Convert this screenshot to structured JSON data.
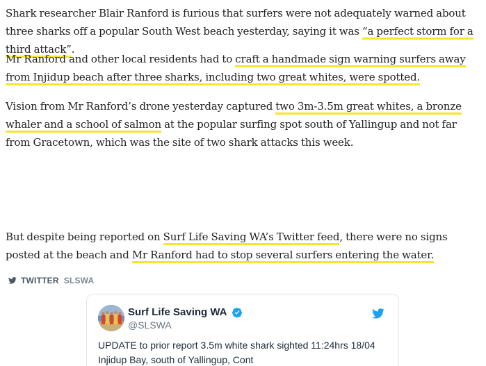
{
  "article": {
    "p1": {
      "t1": "Shark researcher Blair Ranford is furious that surfers were not adequately warned about three sharks off a popular South West beach yesterday, saying it was ",
      "h1": "“a perfect storm for a third attack”",
      "t2": "."
    },
    "p2": {
      "t1": "Mr Ranford and other local residents had to ",
      "h1": "craft a handmade sign warning surfers away from Injidup beach after three sharks, including two great whites, were spotted.",
      "t2": ""
    },
    "p3": {
      "t1": "Vision from Mr Ranford’s drone yesterday captured ",
      "h1": "two 3m-3.5m great whites, a bronze whaler and a school of salmon",
      "t2": " at the popular surfing spot south of Yallingup and not far from Gracetown, which was the site of two shark attacks this week."
    },
    "p4": {
      "t1": "But despite being reported on ",
      "h1": "Surf Life Saving WA’s Twitter feed",
      "t2": ", there were no signs posted at the beach and ",
      "h2": "Mr Ranford had to stop several surfers entering the water.",
      "t3": ""
    }
  },
  "twitter_label": {
    "label": "TWITTER",
    "handle": "SLSWA",
    "icon": "twitter-bird-icon"
  },
  "tweet": {
    "name": "Surf Life Saving WA",
    "handle": "@SLSWA",
    "text": "UPDATE to prior report 3.5m white shark sighted 11:24hrs 18/04 Injidup Bay, south of Yallingup, Cont",
    "verified_icon": "verified-badge-icon",
    "logo_icon": "twitter-bird-icon"
  },
  "colors": {
    "highlight": "#f5e52c",
    "twitter_blue": "#1da1f2",
    "text": "#222222"
  }
}
